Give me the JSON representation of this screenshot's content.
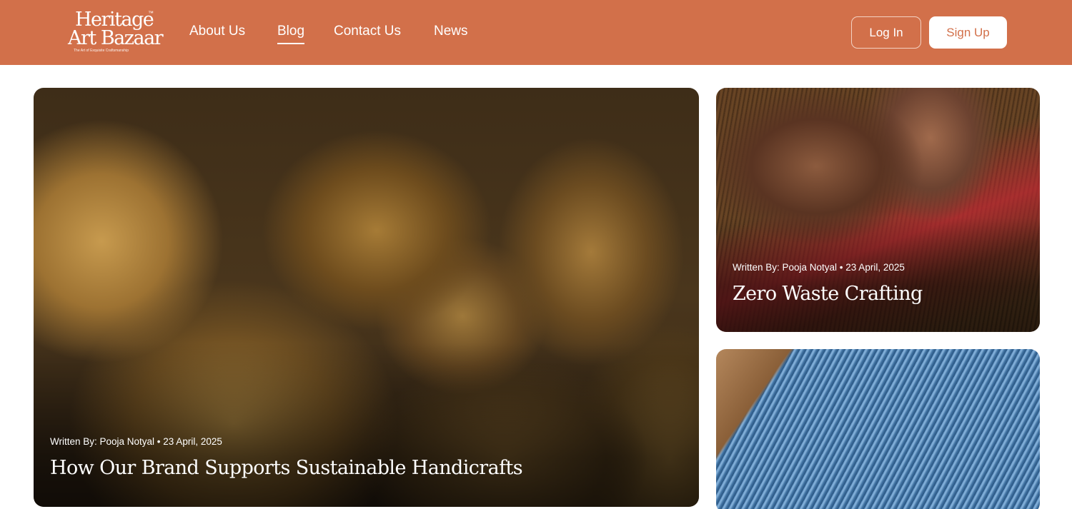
{
  "header": {
    "logo": {
      "line1": "Heritage",
      "line2": "Art Bazaar",
      "trademark": "™",
      "tagline": "The Art of Exquisite Craftsmanship"
    },
    "nav": [
      {
        "label": "About Us",
        "active": false
      },
      {
        "label": "Blog",
        "active": true
      },
      {
        "label": "Contact Us",
        "active": false
      },
      {
        "label": "News",
        "active": false
      }
    ],
    "login_label": "Log In",
    "signup_label": "Sign Up"
  },
  "posts": [
    {
      "meta": "Written By: Pooja Notyal • 23 April, 2025",
      "title": "How Our Brand Supports Sustainable Handicrafts",
      "image": "wicker-baskets-photo"
    },
    {
      "meta": "Written By: Pooja Notyal • 23 April, 2025",
      "title": "Zero Waste Crafting",
      "image": "hand-weaving-loom-photo"
    },
    {
      "meta": "",
      "title": "",
      "image": "blue-threads-loom-photo"
    }
  ],
  "colors": {
    "brand": "#d2704a",
    "header_text": "#ffffff",
    "signup_text": "#d2704a"
  }
}
